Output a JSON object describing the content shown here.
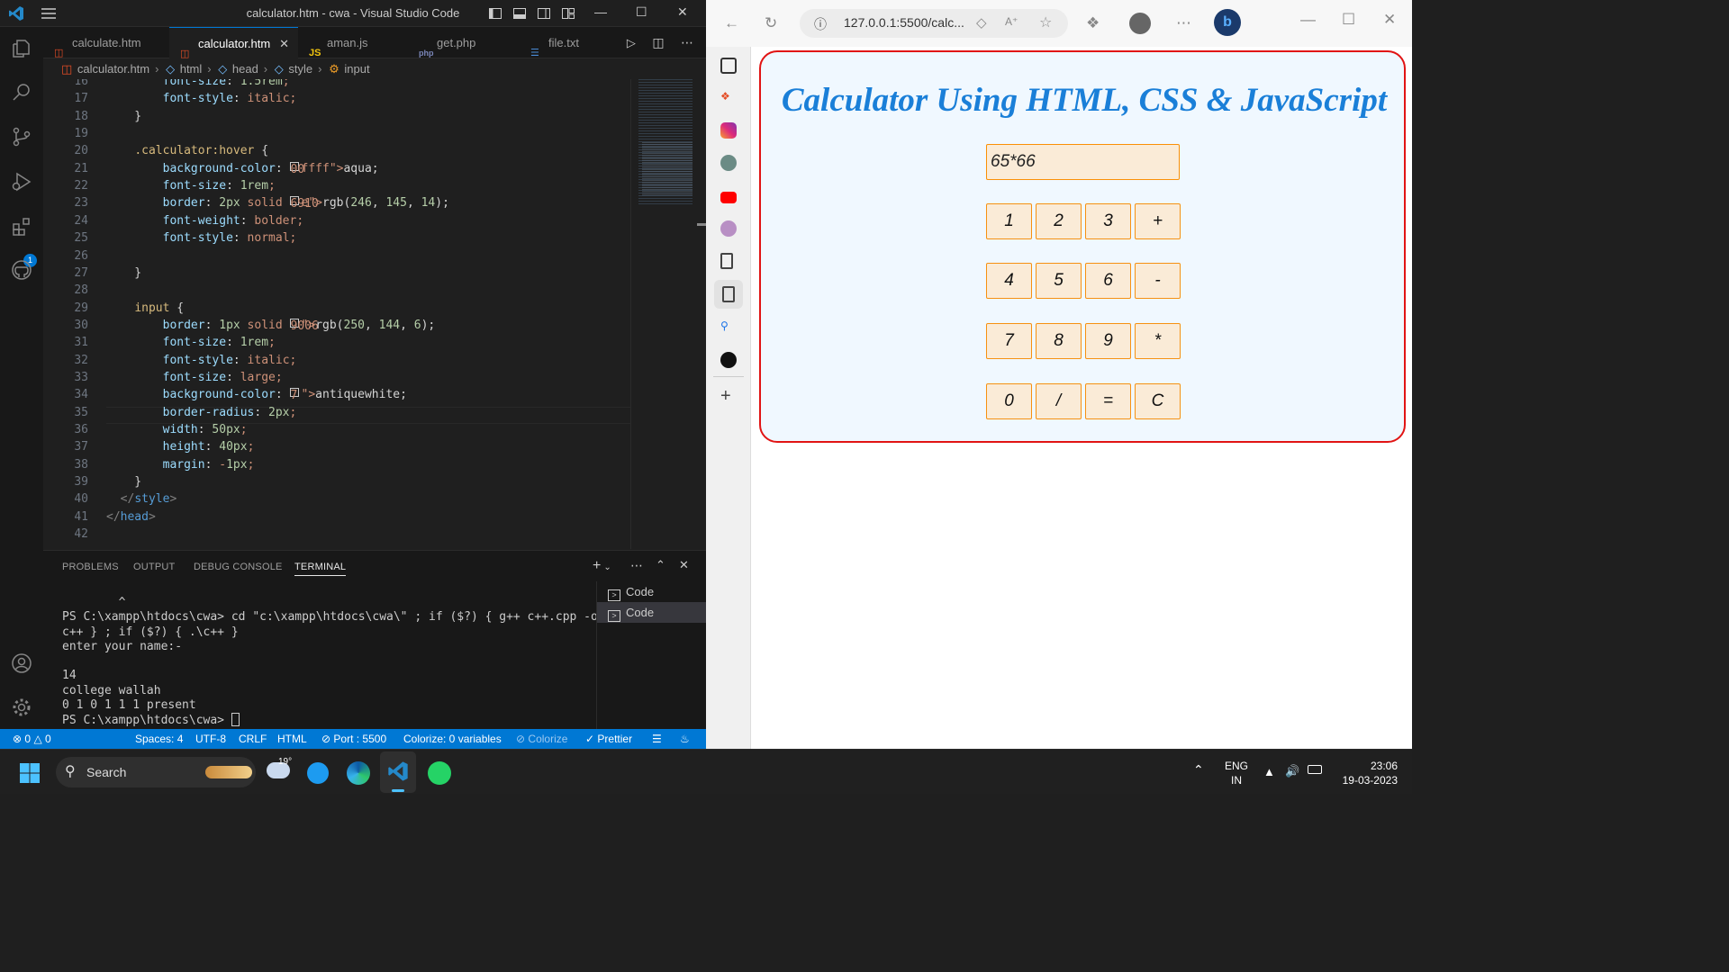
{
  "vscode": {
    "window_title": "calculator.htm - cwa - Visual Studio Code",
    "tabs": [
      {
        "icon": "html-file-icon",
        "label": "calculate.htm",
        "active": false
      },
      {
        "icon": "html-file-icon",
        "label": "calculator.htm",
        "active": true
      },
      {
        "icon": "js-file-icon",
        "label": "aman.js",
        "active": false
      },
      {
        "icon": "php-file-icon",
        "label": "get.php",
        "active": false
      },
      {
        "icon": "text-file-icon",
        "label": "file.txt",
        "active": false
      }
    ],
    "breadcrumb": [
      "calculator.htm",
      "html",
      "head",
      "style",
      "input"
    ],
    "activity_badge": "1",
    "line_numbers": [
      "16",
      "17",
      "18",
      "19",
      "20",
      "21",
      "22",
      "23",
      "24",
      "25",
      "26",
      "27",
      "28",
      "29",
      "30",
      "31",
      "32",
      "33",
      "34",
      "35",
      "36",
      "37",
      "38",
      "39",
      "40",
      "41",
      "42"
    ],
    "code_lines": [
      "        font-size: 1.5rem;",
      "        font-style: italic;",
      "    }",
      "",
      "    .calculator:hover {",
      "        background-color: aqua;",
      "        font-size: 1rem;",
      "        border: 2px solid rgb(246, 145, 14);",
      "        font-weight: bolder;",
      "        font-style: normal;",
      "",
      "    }",
      "",
      "    input {",
      "        border: 1px solid rgb(250, 144, 6);",
      "        font-size: 1rem;",
      "        font-style: italic;",
      "        font-size: large;",
      "        background-color: antiquewhite;",
      "        border-radius: 2px;",
      "        width: 50px;",
      "        height: 40px;",
      "        margin: -1px;",
      "    }",
      "  </style>",
      "</head>",
      ""
    ],
    "color_swatches": {
      "aqua": "#00ffff",
      "rgb(246, 145, 14)": "#f6910e",
      "rgb(250, 144, 6)": "#fa9006",
      "antiquewhite": "#faebd7"
    },
    "panel_tabs": [
      "PROBLEMS",
      "OUTPUT",
      "DEBUG CONSOLE",
      "TERMINAL"
    ],
    "active_panel_tab": "TERMINAL",
    "terminal_lines": [
      "        ^",
      "PS C:\\xampp\\htdocs\\cwa> cd \"c:\\xampp\\htdocs\\cwa\\\" ; if ($?) { g++ c++.cpp -o",
      "c++ } ; if ($?) { .\\c++ }",
      "enter your name:-",
      "",
      "14",
      "college wallah",
      "0 1 0 1 1 1 present",
      "PS C:\\xampp\\htdocs\\cwa> "
    ],
    "terminal_instances": [
      "Code",
      "Code"
    ],
    "status": {
      "errors": "0",
      "warnings": "0",
      "spaces": "Spaces: 4",
      "encoding": "UTF-8",
      "eol": "CRLF",
      "language": "HTML",
      "port": "Port : 5500",
      "colorize_vars": "Colorize: 0 variables",
      "colorize": "Colorize",
      "prettier": "Prettier"
    }
  },
  "browser": {
    "url": "127.0.0.1:5500/calc...",
    "page": {
      "title": "Calculator Using HTML, CSS & JavaScript",
      "display_value": "65*66",
      "keys": [
        [
          "1",
          "2",
          "3",
          "+"
        ],
        [
          "4",
          "5",
          "6",
          "-"
        ],
        [
          "7",
          "8",
          "9",
          "*"
        ],
        [
          "0",
          "/",
          "=",
          "C"
        ]
      ]
    }
  },
  "taskbar": {
    "search_label": "Search",
    "weather_temp": "19°",
    "lang_top": "ENG",
    "lang_bottom": "IN",
    "time": "23:06",
    "date": "19-03-2023"
  },
  "colors": {
    "vscode_bg": "#1f1f1f",
    "status_bar": "#0078d4",
    "calc_border": "#e11414",
    "calc_title": "#1a7fd8",
    "key_bg": "#faebd7",
    "key_border": "#f69112"
  }
}
